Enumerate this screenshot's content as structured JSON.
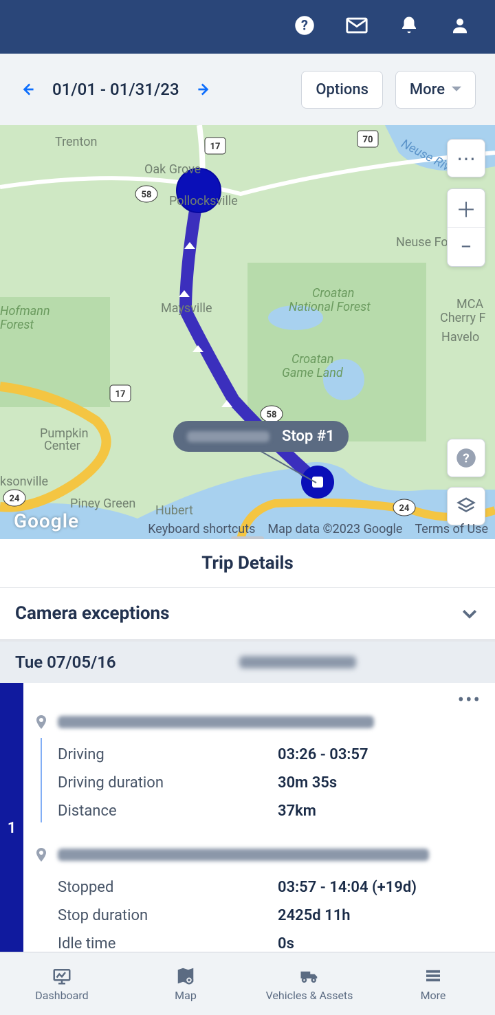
{
  "header": {
    "icons": [
      "help-icon",
      "mail-icon",
      "bell-icon",
      "user-icon"
    ]
  },
  "date_bar": {
    "range": "01/01 - 01/31/23",
    "options_label": "Options",
    "more_label": "More"
  },
  "map": {
    "stop_label": "Stop #1",
    "attrib_keyboard": "Keyboard shortcuts",
    "attrib_data": "Map data ©2023 Google",
    "attrib_terms": "Terms of Use",
    "logo": "Google",
    "places": [
      "Trenton",
      "Oak Grove",
      "Pollocksville",
      "Hofmann Forest",
      "Maysville",
      "Croatan National Forest",
      "Croatan Game Land",
      "Neuse Forest",
      "MCAS Cherry Point",
      "Havelock",
      "Pumpkin Center",
      "Jacksonville",
      "Piney Green",
      "Hubert",
      "Neuse River"
    ],
    "routes": [
      "17",
      "58",
      "70",
      "24",
      "17",
      "58",
      "24"
    ]
  },
  "trip_details_title": "Trip Details",
  "camera_exceptions": "Camera exceptions",
  "date_row": "Tue 07/05/16",
  "segment": {
    "index": "1",
    "driving_label": "Driving",
    "driving_value": "03:26 - 03:57",
    "driving_duration_label": "Driving duration",
    "driving_duration_value": "30m 35s",
    "distance_label": "Distance",
    "distance_value": "37km",
    "stopped_label": "Stopped",
    "stopped_value": "03:57 - 14:04 (+19d)",
    "stop_duration_label": "Stop duration",
    "stop_duration_value": "2425d 11h",
    "idle_label": "Idle time",
    "idle_value": "0s"
  },
  "bottom_nav": {
    "dashboard": "Dashboard",
    "map": "Map",
    "vehicles": "Vehicles & Assets",
    "more": "More"
  }
}
